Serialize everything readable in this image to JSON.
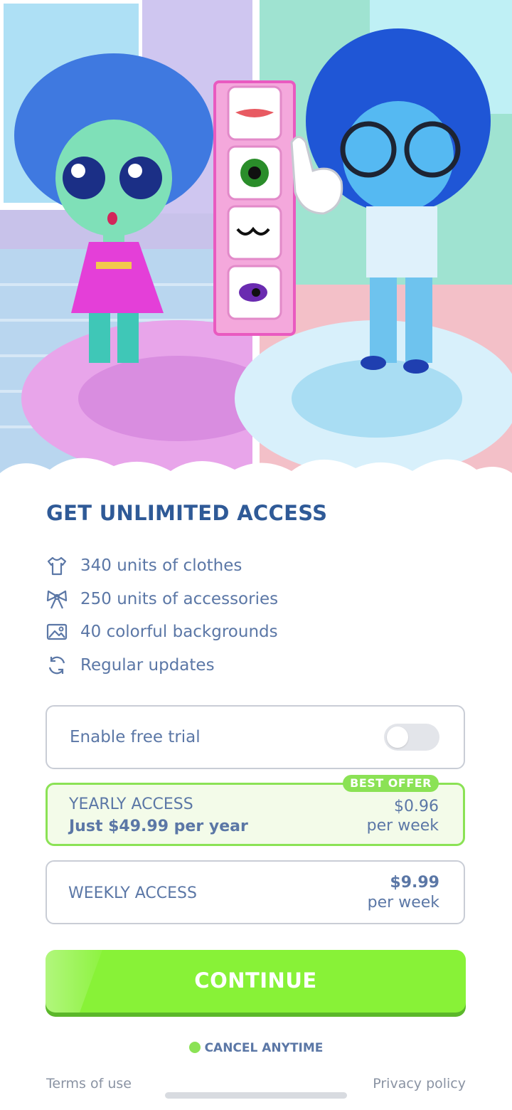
{
  "paywall": {
    "title": "GET UNLIMITED ACCESS",
    "features": [
      {
        "icon": "shirt-icon",
        "label": "340 units of clothes"
      },
      {
        "icon": "bow-icon",
        "label": "250 units of accessories"
      },
      {
        "icon": "image-icon",
        "label": "40 colorful backgrounds"
      },
      {
        "icon": "refresh-icon",
        "label": "Regular updates"
      }
    ],
    "free_trial": {
      "label": "Enable free trial",
      "enabled": false
    },
    "plans": {
      "yearly": {
        "badge": "BEST OFFER",
        "name": "YEARLY ACCESS",
        "sub": "Just $49.99 per year",
        "price": "$0.96",
        "per": "per week",
        "selected": true
      },
      "weekly": {
        "name": "WEEKLY ACCESS",
        "price": "$9.99",
        "per": "per week",
        "selected": false
      }
    },
    "continue_label": "CONTINUE",
    "cancel_label": "CANCEL ANYTIME",
    "terms_label": "Terms of use",
    "privacy_label": "Privacy policy"
  },
  "colors": {
    "accent_green": "#88f237",
    "title_blue": "#2f5a97",
    "text_blue": "#5b77a6"
  }
}
